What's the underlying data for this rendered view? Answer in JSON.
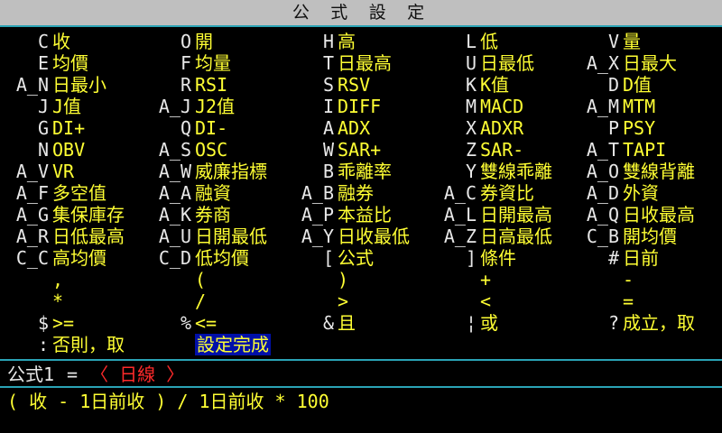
{
  "window": {
    "title": "公 式 設 定"
  },
  "columns": [
    [
      {
        "code": "C",
        "label": "收"
      },
      {
        "code": "E",
        "label": "均價"
      },
      {
        "code": "A_N",
        "label": "日最小"
      },
      {
        "code": "J",
        "label": "J值"
      },
      {
        "code": "G",
        "label": "DI+"
      },
      {
        "code": "N",
        "label": "OBV"
      },
      {
        "code": "A_V",
        "label": "VR"
      },
      {
        "code": "A_F",
        "label": "多空值"
      },
      {
        "code": "A_G",
        "label": "集保庫存"
      },
      {
        "code": "A_R",
        "label": "日低最高"
      },
      {
        "code": "C_C",
        "label": "高均價"
      },
      {
        "code": "",
        "label": ","
      },
      {
        "code": "",
        "label": "*"
      },
      {
        "code": "$",
        "label": ">="
      },
      {
        "code": ":",
        "label": "否則，取"
      }
    ],
    [
      {
        "code": "O",
        "label": "開"
      },
      {
        "code": "F",
        "label": "均量"
      },
      {
        "code": "R",
        "label": "RSI"
      },
      {
        "code": "A_J",
        "label": "J2值"
      },
      {
        "code": "Q",
        "label": "DI-"
      },
      {
        "code": "A_S",
        "label": "OSC"
      },
      {
        "code": "A_W",
        "label": "威廉指標"
      },
      {
        "code": "A_A",
        "label": "融資"
      },
      {
        "code": "A_K",
        "label": "券商"
      },
      {
        "code": "A_U",
        "label": "日開最低"
      },
      {
        "code": "C_D",
        "label": "低均價"
      },
      {
        "code": "",
        "label": "("
      },
      {
        "code": "",
        "label": "/"
      },
      {
        "code": "%",
        "label": "<="
      },
      {
        "code": "",
        "label": "設定完成",
        "selected": true
      }
    ],
    [
      {
        "code": "H",
        "label": "高"
      },
      {
        "code": "T",
        "label": "日最高"
      },
      {
        "code": "S",
        "label": "RSV"
      },
      {
        "code": "I",
        "label": "DIFF"
      },
      {
        "code": "A",
        "label": "ADX"
      },
      {
        "code": "W",
        "label": "SAR+"
      },
      {
        "code": "B",
        "label": "乖離率"
      },
      {
        "code": "A_B",
        "label": "融券"
      },
      {
        "code": "A_P",
        "label": "本益比"
      },
      {
        "code": "A_Y",
        "label": "日收最低"
      },
      {
        "code": "[",
        "label": "公式"
      },
      {
        "code": "",
        "label": ")"
      },
      {
        "code": "",
        "label": ">"
      },
      {
        "code": "&",
        "label": "且"
      },
      {
        "code": "",
        "label": ""
      }
    ],
    [
      {
        "code": "L",
        "label": "低"
      },
      {
        "code": "U",
        "label": "日最低"
      },
      {
        "code": "K",
        "label": "K值"
      },
      {
        "code": "M",
        "label": "MACD"
      },
      {
        "code": "X",
        "label": "ADXR"
      },
      {
        "code": "Z",
        "label": "SAR-"
      },
      {
        "code": "Y",
        "label": "雙線乖離"
      },
      {
        "code": "A_C",
        "label": "券資比"
      },
      {
        "code": "A_L",
        "label": "日開最高"
      },
      {
        "code": "A_Z",
        "label": "日高最低"
      },
      {
        "code": "]",
        "label": "條件"
      },
      {
        "code": "",
        "label": "+"
      },
      {
        "code": "",
        "label": "<"
      },
      {
        "code": "¦",
        "label": "或"
      },
      {
        "code": "",
        "label": ""
      }
    ],
    [
      {
        "code": "V",
        "label": "量"
      },
      {
        "code": "A_X",
        "label": "日最大"
      },
      {
        "code": "D",
        "label": "D值"
      },
      {
        "code": "A_M",
        "label": "MTM"
      },
      {
        "code": "P",
        "label": "PSY"
      },
      {
        "code": "A_T",
        "label": "TAPI"
      },
      {
        "code": "A_O",
        "label": "雙線背離"
      },
      {
        "code": "A_D",
        "label": "外資"
      },
      {
        "code": "A_Q",
        "label": "日收最高"
      },
      {
        "code": "C_B",
        "label": "開均價"
      },
      {
        "code": "#",
        "label": "日前"
      },
      {
        "code": "",
        "label": "-"
      },
      {
        "code": "",
        "label": "="
      },
      {
        "code": "?",
        "label": "成立，取"
      },
      {
        "code": "",
        "label": ""
      }
    ]
  ],
  "formula": {
    "name": "公式1",
    "equals": "=",
    "value": "〈 日線 〉",
    "expression": "( 收 - 1日前收 ) / 1日前收 * 100"
  },
  "colors": {
    "background": "#000000",
    "code": "#e8e8e8",
    "label": "#ffff33",
    "selected_bg": "#0010a8",
    "accent_line": "#2aa3b5",
    "formula_value": "#ff2a2a"
  }
}
